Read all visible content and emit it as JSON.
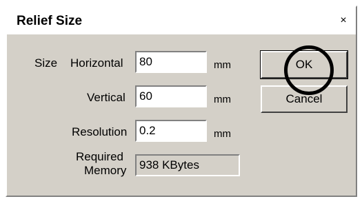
{
  "window": {
    "title": "Relief Size",
    "close_glyph": "×"
  },
  "form": {
    "size_label": "Size",
    "horizontal_label": "Horizontal",
    "horizontal_value": "80",
    "horizontal_unit": "mm",
    "vertical_label": "Vertical",
    "vertical_value": "60",
    "vertical_unit": "mm",
    "resolution_label": "Resolution",
    "resolution_value": "0.2",
    "resolution_unit": "mm",
    "memory_label_line1": "Required",
    "memory_label_line2": "Memory",
    "memory_value": "938 KBytes"
  },
  "buttons": {
    "ok": "OK",
    "cancel": "Cancel"
  },
  "colors": {
    "dialog_bg": "#d4d0c8",
    "highlight_ring": "#000000"
  }
}
